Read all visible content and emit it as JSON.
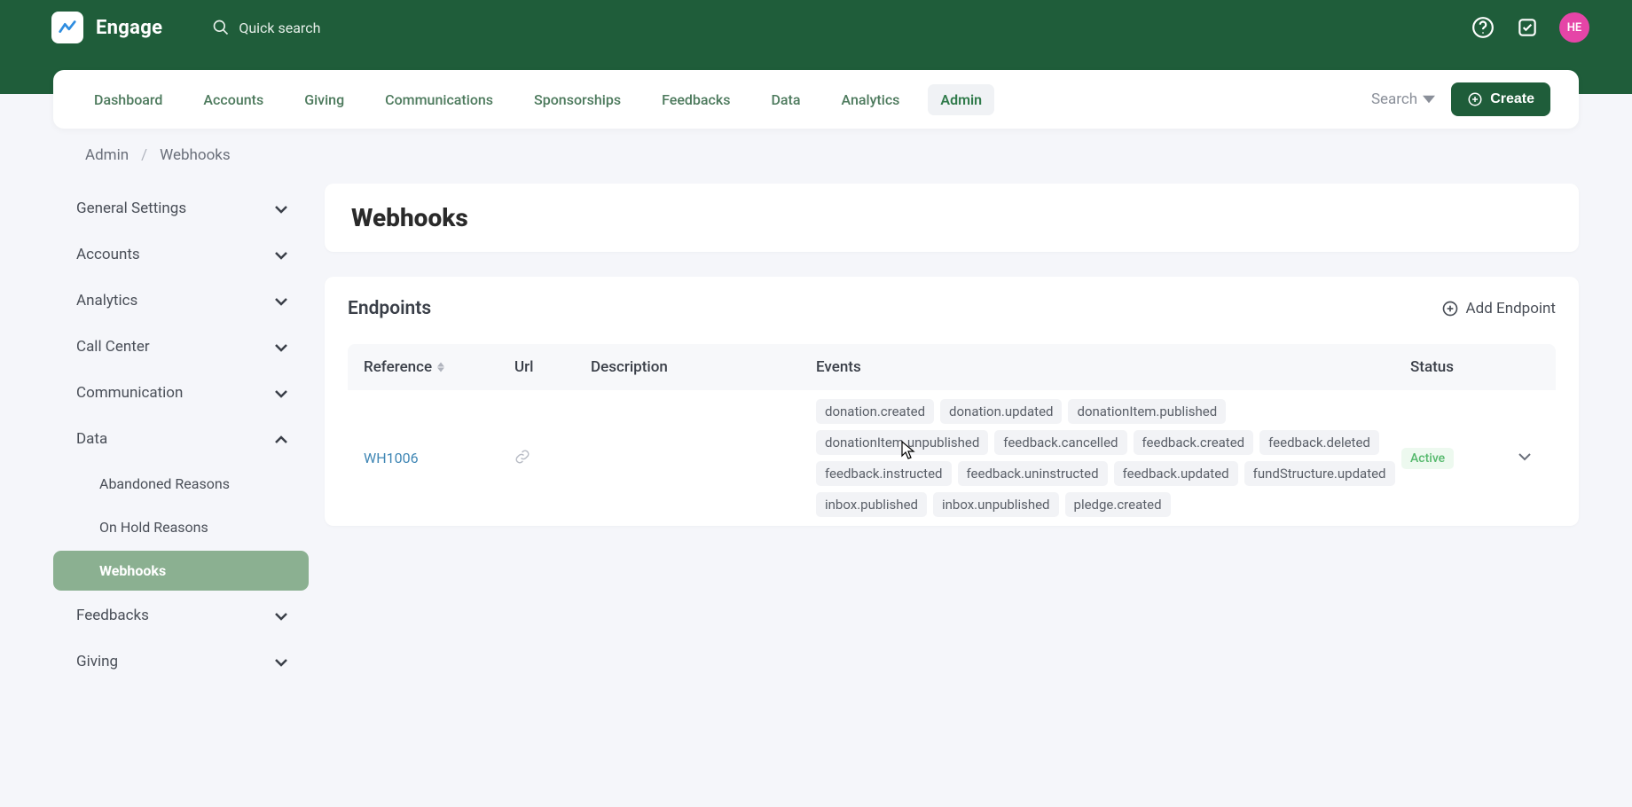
{
  "brand": "Engage",
  "quick_search": "Quick search",
  "avatar_initials": "HE",
  "nav": {
    "tabs": [
      "Dashboard",
      "Accounts",
      "Giving",
      "Communications",
      "Sponsorships",
      "Feedbacks",
      "Data",
      "Analytics",
      "Admin"
    ],
    "active": "Admin",
    "search_label": "Search",
    "create_label": "Create"
  },
  "breadcrumb": {
    "root": "Admin",
    "page": "Webhooks"
  },
  "sidebar": {
    "items": [
      {
        "label": "General Settings",
        "expanded": false
      },
      {
        "label": "Accounts",
        "expanded": false
      },
      {
        "label": "Analytics",
        "expanded": false
      },
      {
        "label": "Call Center",
        "expanded": false
      },
      {
        "label": "Communication",
        "expanded": false
      },
      {
        "label": "Data",
        "expanded": true,
        "children": [
          {
            "label": "Abandoned Reasons",
            "active": false
          },
          {
            "label": "On Hold Reasons",
            "active": false
          },
          {
            "label": "Webhooks",
            "active": true
          }
        ]
      },
      {
        "label": "Feedbacks",
        "expanded": false
      },
      {
        "label": "Giving",
        "expanded": false
      }
    ]
  },
  "page": {
    "title": "Webhooks",
    "section_title": "Endpoints",
    "add_label": "Add Endpoint",
    "columns": {
      "ref": "Reference",
      "url": "Url",
      "desc": "Description",
      "events": "Events",
      "status": "Status"
    },
    "row": {
      "reference": "WH1006",
      "events": [
        "donation.created",
        "donation.updated",
        "donationItem.published",
        "donationItem.unpublished",
        "feedback.cancelled",
        "feedback.created",
        "feedback.deleted",
        "feedback.instructed",
        "feedback.uninstructed",
        "feedback.updated",
        "fundStructure.updated",
        "inbox.published",
        "inbox.unpublished",
        "pledge.created"
      ],
      "status": "Active"
    }
  }
}
